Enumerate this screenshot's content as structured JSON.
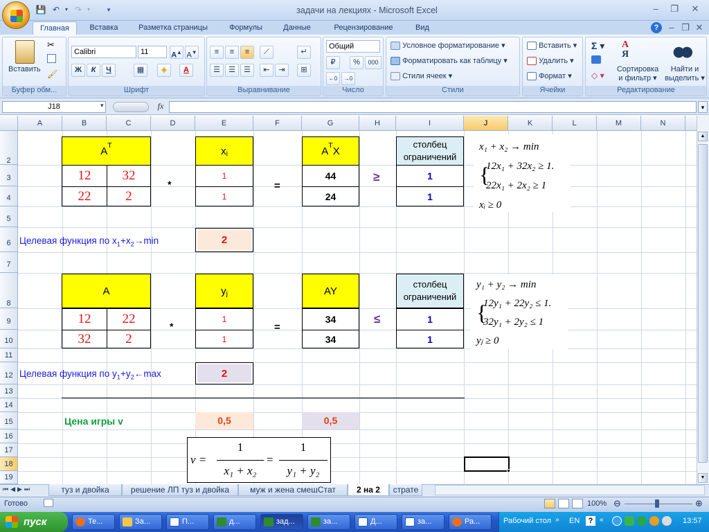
{
  "window": {
    "title": "задачи на лекциях - Microsoft Excel"
  },
  "tabs": [
    "Главная",
    "Вставка",
    "Разметка страницы",
    "Формулы",
    "Данные",
    "Рецензирование",
    "Вид"
  ],
  "ribbon": {
    "clipboard": {
      "label": "Буфер обм...",
      "paste": "Вставить"
    },
    "font": {
      "label": "Шрифт",
      "name": "Calibri",
      "size": "11",
      "bold": "Ж",
      "italic": "К",
      "underline": "Ч"
    },
    "alignment": {
      "label": "Выравнивание"
    },
    "number": {
      "label": "Число",
      "format": "Общий",
      "percent": "%",
      "thousands": "000"
    },
    "styles": {
      "label": "Стили",
      "cond": "Условное форматирование",
      "table": "Форматировать как таблицу",
      "cell": "Стили ячеек"
    },
    "cells": {
      "label": "Ячейки",
      "insert": "Вставить",
      "delete": "Удалить",
      "format": "Формат"
    },
    "editing": {
      "label": "Редактирование",
      "sort1": "Сортировка",
      "sort2": "и фильтр",
      "find1": "Найти и",
      "find2": "выделить"
    }
  },
  "formula_bar": {
    "name_box": "J18",
    "fx": "fx",
    "value": ""
  },
  "columns": [
    "A",
    "B",
    "C",
    "D",
    "E",
    "F",
    "G",
    "H",
    "I",
    "J",
    "K",
    "L",
    "M",
    "N"
  ],
  "rows": [
    "2",
    "3",
    "4",
    "5",
    "6",
    "7",
    "8",
    "9",
    "10",
    "11",
    "12",
    "13",
    "14",
    "15",
    "16",
    "17",
    "18",
    "19"
  ],
  "sheet": {
    "t1": {
      "header": "A",
      "sup": "T",
      "b3": "12",
      "c3": "32",
      "b4": "22",
      "c4": "2"
    },
    "mul": "*",
    "eq": "=",
    "x": {
      "header": "x",
      "sub": "i",
      "e3": "1",
      "e4": "1"
    },
    "atx": {
      "pre": "A",
      "sup": "T",
      "post": "X",
      "g3": "44",
      "g4": "24"
    },
    "ge": "≥",
    "le": "≤",
    "cons": {
      "header": "столбец ограничений",
      "i3": "1",
      "i4": "1",
      "i9": "1",
      "i10": "1"
    },
    "obj1": {
      "label_pre": "Целевая функция по x",
      "s1": "1",
      "mid": "+x",
      "s2": "2",
      "post": "→min",
      "value": "2"
    },
    "t2": {
      "header": "A",
      "b9": "12",
      "c9": "22",
      "b10": "32",
      "c10": "2"
    },
    "y": {
      "header": "y",
      "sub": "j",
      "e9": "1",
      "e10": "1"
    },
    "ay": {
      "header": "AY",
      "g9": "34",
      "g10": "34"
    },
    "obj2": {
      "label_pre": "Целевая функция по y",
      "s1": "1",
      "mid": "+y",
      "s2": "2",
      "post": "←max",
      "value": "2"
    },
    "price": {
      "label": "Цена игры v",
      "e15": "0,5",
      "g15": "0,5"
    },
    "sys1": {
      "l1": "x₁ + x₂ → min",
      "l2": "12x₁ + 32x₂ ≥ 1.",
      "l3": "22x₁ + 2x₂ ≥ 1",
      "l4": "xᵢ ≥ 0"
    },
    "sys2": {
      "l1": "y₁ + y₂ → min",
      "l2": "12y₁ + 22y₂ ≤ 1.",
      "l3": "32y₁ + 2y₂ ≤ 1",
      "l4": "yⱼ ≥ 0"
    },
    "formula": {
      "v": "ν =",
      "n1": "1",
      "d1": "x₁ + x₂",
      "eq": "=",
      "n2": "1",
      "d2": "y₁ + y₂"
    }
  },
  "sheet_tabs": [
    "туз и двойка",
    "решение ЛП туз и двойка",
    "муж и жена смешСтат",
    "2 на 2",
    "страте"
  ],
  "status": {
    "ready": "Готово",
    "zoom": "100%"
  },
  "taskbar": {
    "start": "пуск",
    "items": [
      "Те...",
      "За...",
      "П...",
      "д...",
      "зад...",
      "за...",
      "Д...",
      "за...",
      "Ра..."
    ],
    "desktop": "Рабочий стол",
    "lang": "EN",
    "clock": "13:57"
  }
}
